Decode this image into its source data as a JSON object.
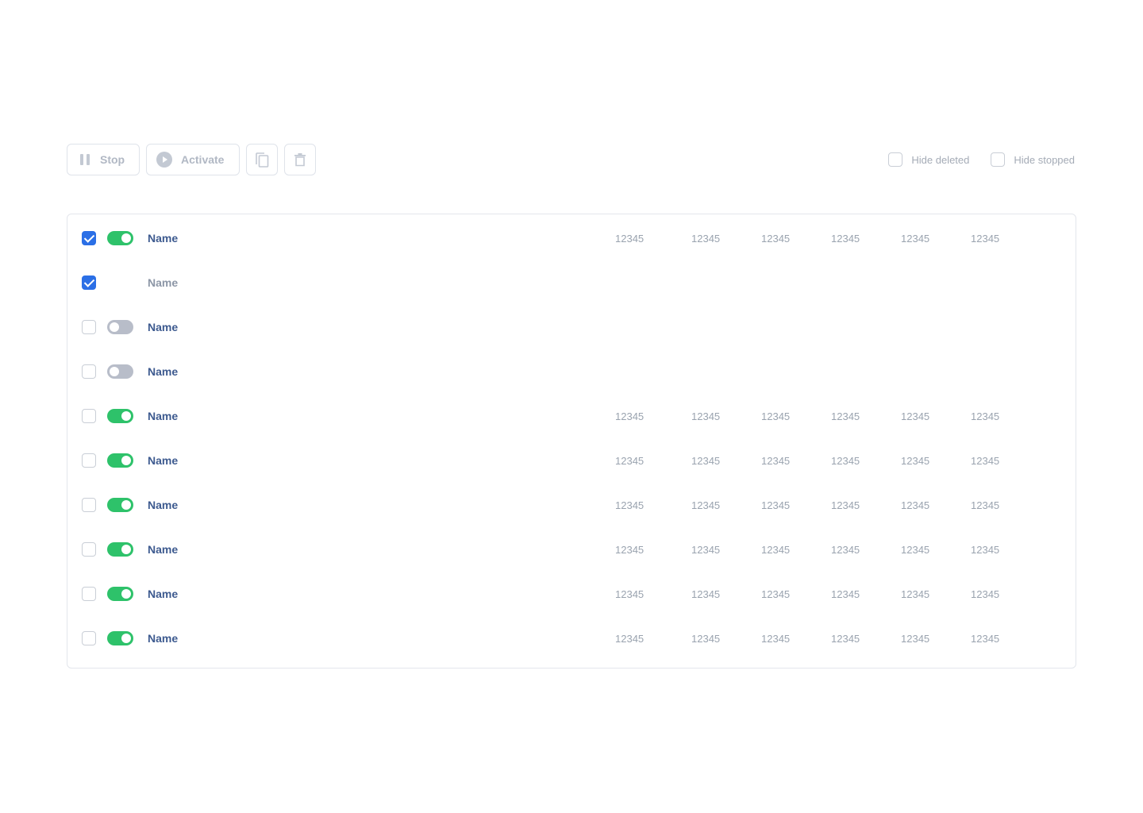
{
  "toolbar": {
    "stop_label": "Stop",
    "activate_label": "Activate",
    "hide_deleted_label": "Hide deleted",
    "hide_stopped_label": "Hide stopped",
    "hide_deleted_checked": false,
    "hide_stopped_checked": false
  },
  "colors": {
    "accent": "#2b6fe6",
    "toggle_on": "#2ec26a",
    "toggle_off": "#b8bdc9",
    "name_text": "#3d5a8f"
  },
  "rows": [
    {
      "checked": true,
      "toggle": "on",
      "name": "Name",
      "values": [
        "12345",
        "12345",
        "12345",
        "12345",
        "12345",
        "12345"
      ]
    },
    {
      "checked": true,
      "toggle": "none",
      "name": "Name",
      "values": []
    },
    {
      "checked": false,
      "toggle": "off",
      "name": "Name",
      "values": []
    },
    {
      "checked": false,
      "toggle": "off",
      "name": "Name",
      "values": []
    },
    {
      "checked": false,
      "toggle": "on",
      "name": "Name",
      "values": [
        "12345",
        "12345",
        "12345",
        "12345",
        "12345",
        "12345"
      ]
    },
    {
      "checked": false,
      "toggle": "on",
      "name": "Name",
      "values": [
        "12345",
        "12345",
        "12345",
        "12345",
        "12345",
        "12345"
      ]
    },
    {
      "checked": false,
      "toggle": "on",
      "name": "Name",
      "values": [
        "12345",
        "12345",
        "12345",
        "12345",
        "12345",
        "12345"
      ]
    },
    {
      "checked": false,
      "toggle": "on",
      "name": "Name",
      "values": [
        "12345",
        "12345",
        "12345",
        "12345",
        "12345",
        "12345"
      ]
    },
    {
      "checked": false,
      "toggle": "on",
      "name": "Name",
      "values": [
        "12345",
        "12345",
        "12345",
        "12345",
        "12345",
        "12345"
      ]
    },
    {
      "checked": false,
      "toggle": "on",
      "name": "Name",
      "values": [
        "12345",
        "12345",
        "12345",
        "12345",
        "12345",
        "12345"
      ]
    }
  ]
}
